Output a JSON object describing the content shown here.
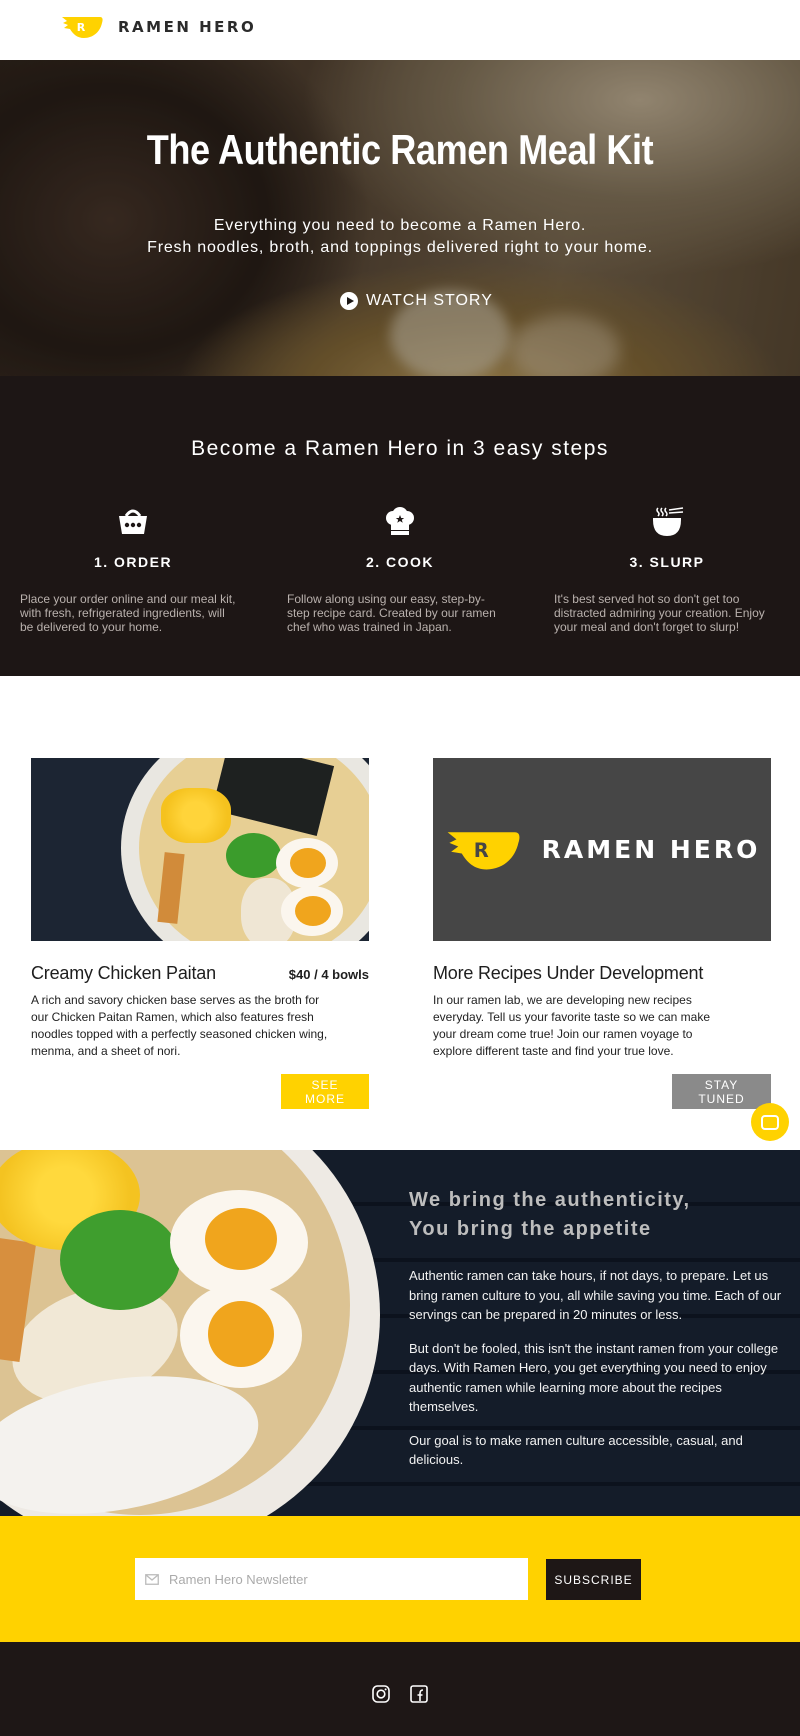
{
  "brand": {
    "name": "RAMEN HERO",
    "logo_letter": "R",
    "accent": "#ffd200",
    "dark": "#1d1615"
  },
  "hero": {
    "title": "The Authentic Ramen Meal Kit",
    "subtitle_line1": "Everything you need to become a Ramen Hero.",
    "subtitle_line2": "Fresh noodles, broth, and toppings delivered right to your home.",
    "cta_label": "WATCH STORY",
    "cta_icon": "play-circle-icon"
  },
  "steps": {
    "heading": "Become a Ramen Hero in 3 easy steps",
    "items": [
      {
        "icon": "basket-icon",
        "label": "1. ORDER",
        "text": "Place your order online and our meal kit, with fresh, refrigerated ingredients, will be delivered to your home."
      },
      {
        "icon": "chef-hat-icon",
        "label": "2. COOK",
        "text": "Follow along using our easy, step-by-step recipe card. Created by our ramen chef who was trained in Japan."
      },
      {
        "icon": "steaming-bowl-icon",
        "label": "3. SLURP",
        "text": "It's best served hot so don't get too distracted admiring your creation. Enjoy your meal and don't forget to slurp!"
      }
    ]
  },
  "products": [
    {
      "name": "Creamy Chicken Paitan",
      "price": "$40 / 4 bowls",
      "description": "A rich and savory chicken base serves as the broth for our Chicken Paitan Ramen, which also features fresh noodles topped with a perfectly seasoned chicken wing, menma, and a sheet of nori.",
      "button": "SEE MORE"
    },
    {
      "name": "More Recipes Under Development",
      "price": "",
      "description": "In our ramen lab, we are developing new recipes everyday. Tell us your favorite taste so we can make your dream come true! Join our ramen voyage to explore different taste and find your true love.",
      "button": "STAY TUNED",
      "tile_word": "RAMEN HERO"
    }
  ],
  "about": {
    "heading_line1": "We bring the authenticity,",
    "heading_line2": "You bring the appetite",
    "paragraphs": [
      "Authentic ramen can take hours, if not days, to prepare. Let us bring ramen culture to you, all while saving you time. Each of our servings can be prepared in 20 minutes or less.",
      "But don't be fooled, this isn't the instant ramen from your college days. With Ramen Hero, you get everything you need to enjoy authentic ramen while learning more about the recipes themselves.",
      "Our goal is to make ramen culture accessible, casual, and delicious."
    ]
  },
  "newsletter": {
    "placeholder": "Ramen Hero Newsletter",
    "button": "SUBSCRIBE",
    "icon": "mail-icon"
  },
  "footer": {
    "social": [
      "instagram-icon",
      "facebook-icon"
    ]
  },
  "chat": {
    "icon": "chat-icon"
  }
}
